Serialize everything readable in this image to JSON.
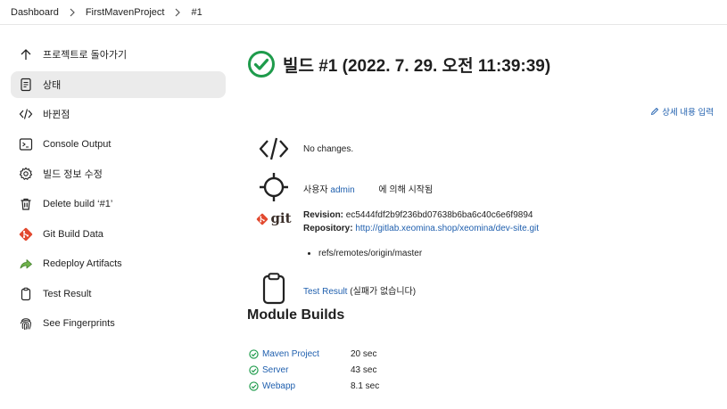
{
  "breadcrumb": {
    "items": [
      "Dashboard",
      "FirstMavenProject",
      "#1"
    ]
  },
  "sidebar": {
    "items": [
      {
        "label": "프로젝트로 돌아가기",
        "icon": "arrow-up-icon"
      },
      {
        "label": "상태",
        "icon": "document-icon",
        "active": true
      },
      {
        "label": "바뀐점",
        "icon": "code-icon"
      },
      {
        "label": "Console Output",
        "icon": "terminal-icon"
      },
      {
        "label": "빌드 정보 수정",
        "icon": "gear-icon"
      },
      {
        "label": "Delete build ‘#1’",
        "icon": "trash-icon"
      },
      {
        "label": "Git Build Data",
        "icon": "git-icon"
      },
      {
        "label": "Redeploy Artifacts",
        "icon": "redeploy-arrow-icon"
      },
      {
        "label": "Test Result",
        "icon": "clipboard-icon"
      },
      {
        "label": "See Fingerprints",
        "icon": "fingerprint-icon"
      }
    ]
  },
  "main": {
    "title": "빌드 #1 (2022. 7. 29. 오전 11:39:39)",
    "edit_description": "상세 내용 입력",
    "changes_text": "No changes.",
    "started_by_prefix": "사용자",
    "started_by_user": "admin",
    "started_by_suffix": "에 의해 시작됨",
    "git": {
      "logo_text": "git",
      "revision_label": "Revision:",
      "revision_value": "ec5444fdf2b9f236bd07638b6ba6c40c6e6f9894",
      "repository_label": "Repository:",
      "repository_url": "http://gitlab.xeomina.shop/xeomina/dev-site.git",
      "refs": [
        "refs/remotes/origin/master"
      ]
    },
    "test_result_link": "Test Result",
    "test_result_note": "(실패가 없습니다)",
    "module_builds_title": "Module Builds",
    "modules": [
      {
        "name": "Maven Project",
        "duration": "20 sec"
      },
      {
        "name": "Server",
        "duration": "43 sec"
      },
      {
        "name": "Webapp",
        "duration": "8.1 sec"
      }
    ]
  },
  "colors": {
    "success": "#1e9b4b",
    "link": "#1f5fae",
    "active_nav_bg": "#ebebeb",
    "git_orange": "#e2492f"
  }
}
